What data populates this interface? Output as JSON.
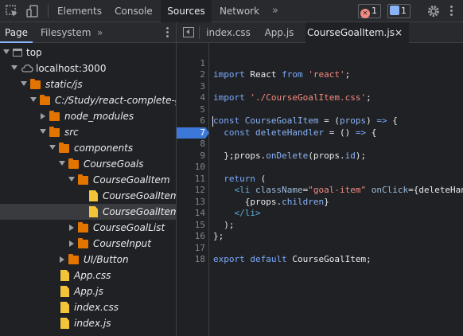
{
  "toolbar": {
    "tabs": [
      {
        "label": "Elements"
      },
      {
        "label": "Console"
      },
      {
        "label": "Sources"
      },
      {
        "label": "Network"
      }
    ],
    "more_label": "»",
    "errors_count": "1",
    "messages_count": "1"
  },
  "sidebar": {
    "tabs": [
      {
        "label": "Page"
      },
      {
        "label": "Filesystem"
      }
    ],
    "more_label": "»",
    "tree": [
      {
        "label": "top"
      },
      {
        "label": "localhost:3000"
      },
      {
        "label": "static/js"
      },
      {
        "label": "C:/Study/react-complete-guid"
      },
      {
        "label": "node_modules"
      },
      {
        "label": "src"
      },
      {
        "label": "components"
      },
      {
        "label": "CourseGoals"
      },
      {
        "label": "CourseGoalItem"
      },
      {
        "label": "CourseGoalItem.c"
      },
      {
        "label": "CourseGoalItem.js"
      },
      {
        "label": "CourseGoalList"
      },
      {
        "label": "CourseInput"
      },
      {
        "label": "UI/Button"
      },
      {
        "label": "App.css"
      },
      {
        "label": "App.js"
      },
      {
        "label": "index.css"
      },
      {
        "label": "index.js"
      }
    ]
  },
  "editor": {
    "tabs": [
      {
        "label": "index.css"
      },
      {
        "label": "App.js"
      },
      {
        "label": "CourseGoalItem.js"
      }
    ],
    "close_label": "×",
    "breakpoint_line": 7,
    "lines": [
      {
        "n": "1",
        "text": "import React from 'react';"
      },
      {
        "n": "2",
        "text": ""
      },
      {
        "n": "3",
        "text": "import './CourseGoalItem.css';"
      },
      {
        "n": "4",
        "text": ""
      },
      {
        "n": "5",
        "text": "const CourseGoalItem = (props) => {"
      },
      {
        "n": "6",
        "text": "  const deleteHandler = () => {"
      },
      {
        "n": "7",
        "text": "    props.onDelete(props.id);"
      },
      {
        "n": "8",
        "text": "  };"
      },
      {
        "n": "9",
        "text": ""
      },
      {
        "n": "10",
        "text": "  return ("
      },
      {
        "n": "11",
        "text": "    <li className=\"goal-item\" onClick={deleteHan"
      },
      {
        "n": "12",
        "text": "      {props.children}"
      },
      {
        "n": "13",
        "text": "    </li>"
      },
      {
        "n": "14",
        "text": "  );"
      },
      {
        "n": "15",
        "text": "};"
      },
      {
        "n": "16",
        "text": ""
      },
      {
        "n": "17",
        "text": "export default CourseGoalItem;"
      },
      {
        "n": "18",
        "text": ""
      }
    ]
  }
}
